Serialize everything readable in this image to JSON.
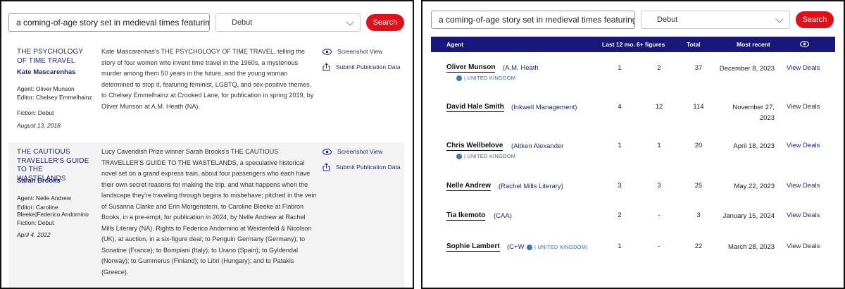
{
  "left": {
    "search": {
      "query": "a coming-of-age story set in medieval times featuring trav",
      "type": "Debut",
      "button": "Search"
    },
    "actions": {
      "screenshot": "Screenshot View",
      "submit": "Submit Publication Data"
    },
    "deals": [
      {
        "title": "THE PSYCHOLOGY OF TIME TRAVEL",
        "author": "Kate Mascarenhas",
        "agent": "Agent: Oliver Munson",
        "editor": "Editor: Chelsey Emmelhainz",
        "fiction": "Fiction: Debut",
        "date": "August 13, 2018",
        "description": "Kate Mascarenhas's THE PSYCHOLOGY OF TIME TRAVEL, telling the story of four women who invent time travel in the 1960s, a mysterious murder among them 50 years in the future, and the young woman determined to stop it, featuring feminist, LGBTQ, and sex-positive themes, to Chelsey Emmelhainz at Crooked Lane, for publication in spring 2019, by Oliver Munson at A.M. Heath (NA)."
      },
      {
        "title": "THE CAUTIOUS TRAVELLER'S GUIDE TO THE WASTELANDS",
        "author": "Sarah Brooks",
        "agent": "Agent: Nelle Andrew",
        "editor": "Editor: Caroline Bleeke|Federico Andornino",
        "fiction": "Fiction: Debut",
        "date": "April 4, 2022",
        "description": "Lucy Cavendish Prize winner Sarah Brooks's THE CAUTIOUS TRAVELLER'S GUIDE TO THE WASTELANDS, a speculative historical novel set on a grand express train, about four passengers who each have their own secret reasons for making the trip, and what happens when the landscape they're traveling through begins to misbehave; pitched in the vein of Susanna Clarke and Erin Morgenstern, to Caroline Bleeke at Flatiron Books, in a pre-empt, for publication in 2024, by Nelle Andrew at Rachel Mills Literary (NA). Rights to Federico Andornino at Weidenfeld & Nicolson (UK), at auction, in a six-figure deal; to Penguin Germany (Germany); to Sonatine (France); to Bompiani (Italy); to Urano (Spain); to Gyldendal (Norway); to Gummerus (Finland); to Libri (Hungary); and to Patakis (Greece)."
      }
    ]
  },
  "right": {
    "search": {
      "query": "a coming-of-age story set in medieval times featuring trav",
      "type": "Debut",
      "button": "Search"
    },
    "headers": {
      "agent": "Agent",
      "last12": "Last 12 mo.",
      "six": "6+ figures",
      "total": "Total",
      "recent": "Most recent"
    },
    "view_label": "View Deals",
    "rows": [
      {
        "name": "Oliver Munson",
        "agency": "(A.M. Heath",
        "country": "| UNITED KINGDOM",
        "last12": "1",
        "six": "2",
        "total": "37",
        "recent": "December 8, 2023"
      },
      {
        "name": "David Hale Smith",
        "agency": "(Inkwell Management)",
        "country": "",
        "last12": "4",
        "six": "12",
        "total": "114",
        "recent": "November 27, 2023"
      },
      {
        "name": "Chris Wellbelove",
        "agency": "(Aitken Alexander",
        "country": "| UNITED KINGDOM",
        "last12": "1",
        "six": "1",
        "total": "20",
        "recent": "April 18, 2023"
      },
      {
        "name": "Nelle Andrew",
        "agency": "(Rachel Mills Literary)",
        "country": "",
        "last12": "3",
        "six": "3",
        "total": "25",
        "recent": "May 22, 2023"
      },
      {
        "name": "Tia Ikemoto",
        "agency": "(CAA)",
        "country": "",
        "last12": "2",
        "six": "-",
        "total": "3",
        "recent": "January 15, 2024"
      },
      {
        "name": "Sophie Lambert",
        "agency": "(C+W",
        "country": "| UNITED KINGDOM)",
        "last12": "1",
        "six": "-",
        "total": "22",
        "recent": "March 28, 2023"
      }
    ]
  }
}
